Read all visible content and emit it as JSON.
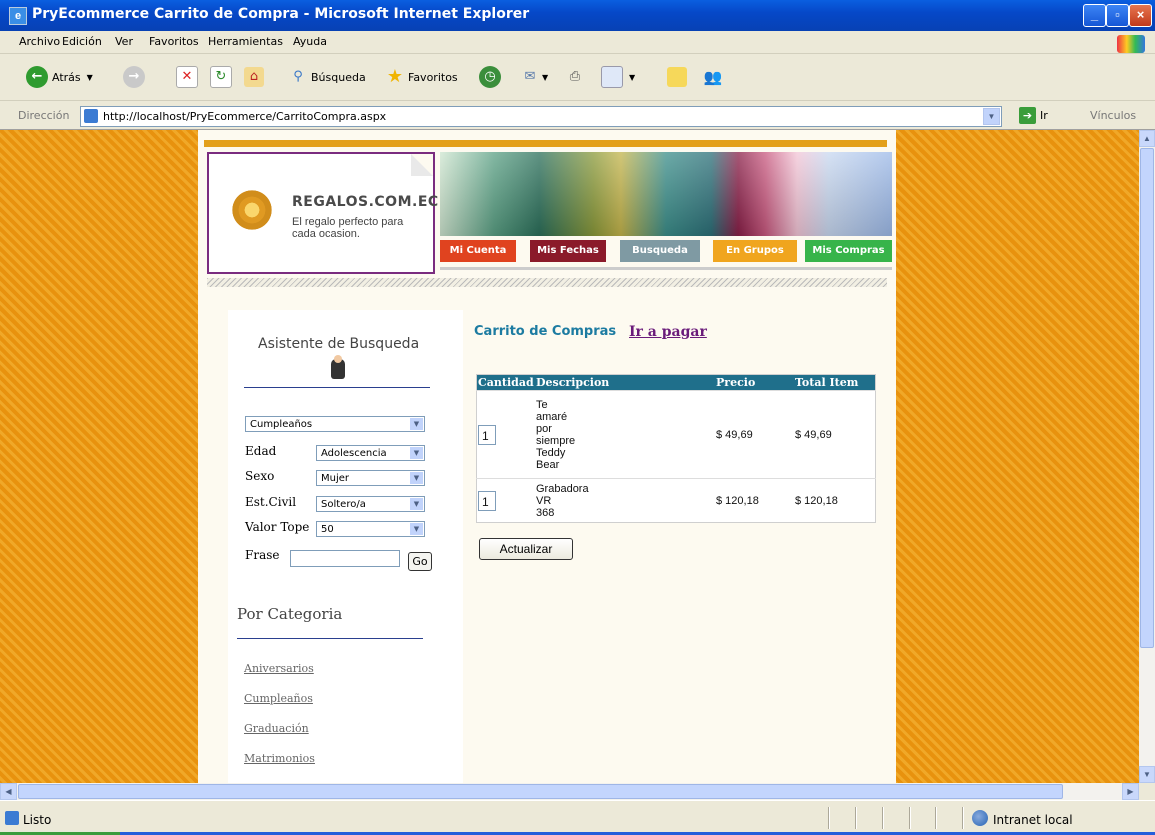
{
  "window": {
    "title": "PryEcommerce Carrito de Compra - Microsoft Internet Explorer",
    "minimize": "_",
    "maximize": "▫",
    "close": "×"
  },
  "menu": [
    "Archivo",
    "Edición",
    "Ver",
    "Favoritos",
    "Herramientas",
    "Ayuda"
  ],
  "toolbar": {
    "back_label": "Atrás",
    "search_label": "Búsqueda",
    "favorites_label": "Favoritos"
  },
  "address": {
    "label": "Dirección",
    "url": "http://localhost/PryEcommerce/CarritoCompra.aspx",
    "go_label": "Ir",
    "links_label": "Vínculos"
  },
  "site": {
    "brand": "REGALOS.COM.EC",
    "tagline": "El regalo perfecto para cada ocasion.",
    "nav_tabs": [
      {
        "label": "Mi Cuenta",
        "color": "#e0431f"
      },
      {
        "label": "Mis Fechas",
        "color": "#8b1a2a"
      },
      {
        "label": "Busqueda",
        "color": "#7f9aa3"
      },
      {
        "label": "En Grupos",
        "color": "#f0a51e"
      },
      {
        "label": "Mis Compras",
        "color": "#37b44a"
      }
    ]
  },
  "sidebar": {
    "title": "Asistente de Busqueda",
    "occasion": "Cumpleaños",
    "fields": [
      {
        "label": "Edad",
        "value": "Adolescencia"
      },
      {
        "label": "Sexo",
        "value": "Mujer"
      },
      {
        "label": "Est.Civil",
        "value": "Soltero/a"
      },
      {
        "label": "Valor Tope",
        "value": "50"
      }
    ],
    "frase_label": "Frase",
    "go_button": "Go",
    "category_title": "Por Categoria",
    "categories": [
      "Aniversarios",
      "Cumpleaños",
      "Graduación",
      "Matrimonios"
    ]
  },
  "cart": {
    "title": "Carrito de Compras",
    "pay_link": "Ir a pagar",
    "headers": [
      "Cantidad",
      "Descripcion",
      "Precio",
      "Total Item"
    ],
    "rows": [
      {
        "qty": "1",
        "description": "Te amaré por siempre Teddy Bear",
        "price": "$ 49,69",
        "total": "$ 49,69"
      },
      {
        "qty": "1",
        "description": "Grabadora VR 368",
        "price": "$ 120,18",
        "total": "$ 120,18"
      }
    ],
    "update_button": "Actualizar"
  },
  "status": {
    "text": "Listo",
    "zone": "Intranet local"
  }
}
